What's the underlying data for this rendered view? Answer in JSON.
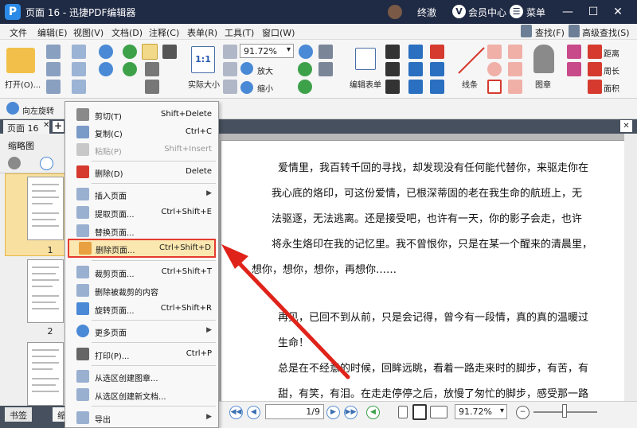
{
  "titlebar": {
    "logo_letter": "P",
    "title": "页面 16 - 迅捷PDF编辑器",
    "user_name": "终澈",
    "vip_letter": "V",
    "vip_label": "会员中心",
    "menu_label": "菜单",
    "menu_glyph": "☰",
    "minimize": "—",
    "maximize": "☐",
    "close": "✕"
  },
  "menubar": {
    "items": [
      "文件",
      "编辑(E)",
      "视图(V)",
      "文档(D)",
      "注释(C)",
      "表单(R)",
      "工具(T)",
      "窗口(W)"
    ],
    "find": "查找(F)",
    "advanced_find": "高级查找(S)"
  },
  "ribbon": {
    "open": "打开(O)...",
    "zoom_value": "91.72%",
    "actual_size_glyph": "1:1",
    "actual_size": "实际大小",
    "zoom_in": "放大",
    "zoom_out": "缩小",
    "edit_form": "编辑表单",
    "line": "线条",
    "stamp": "图章",
    "distance": "距离",
    "perimeter": "周长",
    "area": "面积"
  },
  "toolbar2": {
    "rotate_left": "向左旋转"
  },
  "tabs": {
    "document_tab": "页面 16",
    "close": "✕",
    "plus": "+"
  },
  "sidepanel": {
    "header": "缩略图",
    "page1": "1",
    "page2": "2",
    "bottom_tab1": "书签",
    "bottom_tab2": "缩"
  },
  "document": {
    "lines": [
      "爱情里，我百转千回的寻找，却发现没有任何能代替你，来驱走你在",
      "我心底的烙印，可这份爱情，已根深蒂固的老在我生命的航班上，无",
      "法驱逐，无法逃离。还是接受吧，也许有一天，你的影子会走，也许",
      "将永生烙印在我的记忆里。我不曾恨你，只是在某一个醒来的清晨里，",
      "想你，想你，想你，再想你……",
      "再见，已回不到从前，只是会记得，曾今有一段情，真的真的温暖过",
      "生命！",
      "总是在不经意的时候，回眸远眺，看着一路走来时的脚步，有苦，有",
      "甜，有笑，有泪。在走走停停之后，放慢了匆忙的脚步，感受那一路"
    ]
  },
  "statusbar": {
    "page_value": "1/9",
    "zoom_value": "91.72%"
  },
  "context_menu": {
    "cut": "剪切(T)",
    "cut_sc": "Shift+Delete",
    "copy": "复制(C)",
    "copy_sc": "Ctrl+C",
    "paste": "粘贴(P)",
    "paste_sc": "Shift+Insert",
    "delete": "删除(D)",
    "delete_sc": "Delete",
    "insert_page": "插入页面",
    "extract_page": "提取页面...",
    "extract_sc": "Ctrl+Shift+E",
    "replace_page": "替换页面...",
    "delete_page": "删除页面...",
    "delete_page_sc": "Ctrl+Shift+D",
    "crop_page": "裁剪页面...",
    "crop_sc": "Ctrl+Shift+T",
    "delete_cropped": "删除被裁剪的内容",
    "rotate_page": "旋转页面...",
    "rotate_sc": "Ctrl+Shift+R",
    "more_pages": "更多页面",
    "print": "打印(P)...",
    "print_sc": "Ctrl+P",
    "create_stamp": "从选区创建图章...",
    "create_doc": "从选区创建新文档...",
    "export": "导出",
    "submenu_arrow": "▶"
  },
  "colors": {
    "titlebar": "#1f2a44",
    "highlight_border": "#e53b2f",
    "highlight_fill": "#fbe7b0",
    "arrow": "#e0231a",
    "thumb_selected": "#f7e0a0"
  }
}
